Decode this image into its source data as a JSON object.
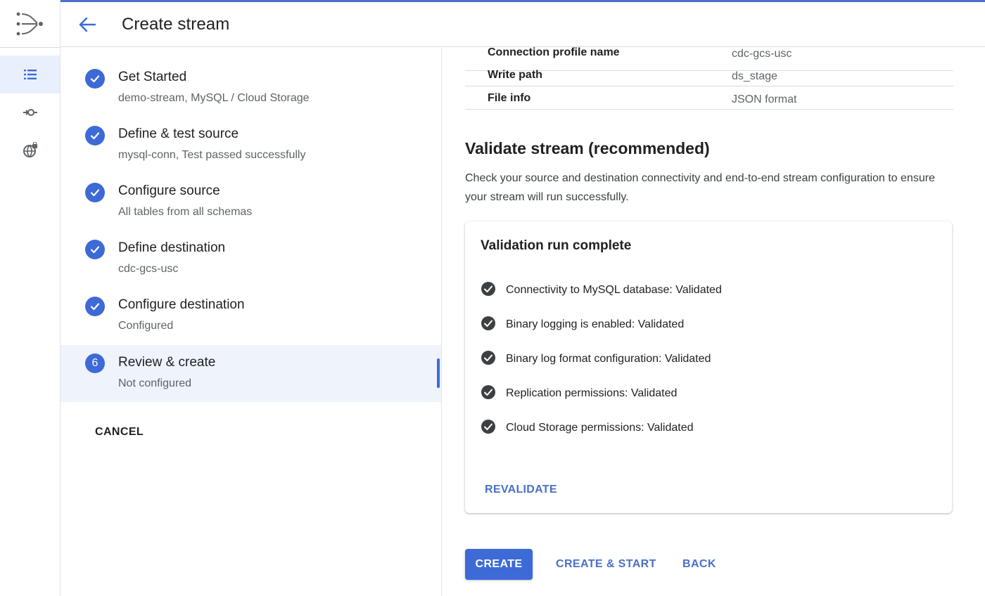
{
  "header": {
    "title": "Create stream"
  },
  "rail": {
    "items": [
      {
        "icon": "list-icon",
        "active": true
      },
      {
        "icon": "connection-profile-icon",
        "active": false
      },
      {
        "icon": "private-connectivity-icon",
        "active": false
      }
    ]
  },
  "stepper": {
    "steps": [
      {
        "title": "Get Started",
        "subtitle": "demo-stream, MySQL / Cloud Storage",
        "status": "complete"
      },
      {
        "title": "Define & test source",
        "subtitle": "mysql-conn, Test passed successfully",
        "status": "complete"
      },
      {
        "title": "Configure source",
        "subtitle": "All tables from all schemas",
        "status": "complete"
      },
      {
        "title": "Define destination",
        "subtitle": "cdc-gcs-usc",
        "status": "complete"
      },
      {
        "title": "Configure destination",
        "subtitle": "Configured",
        "status": "complete"
      },
      {
        "title": "Review & create",
        "subtitle": "Not configured",
        "status": "active",
        "number": "6"
      }
    ],
    "cancel_label": "CANCEL"
  },
  "summary": {
    "rows": [
      {
        "key": "Connection profile name",
        "value": "cdc-gcs-usc"
      },
      {
        "key": "Write path",
        "value": "ds_stage"
      },
      {
        "key": "File info",
        "value": "JSON format"
      }
    ]
  },
  "validate": {
    "title": "Validate stream (recommended)",
    "description": "Check your source and destination connectivity and end-to-end stream configuration to ensure your stream will run successfully.",
    "card_title": "Validation run complete",
    "checks": [
      "Connectivity to MySQL database: Validated",
      "Binary logging is enabled: Validated",
      "Binary log format configuration: Validated",
      "Replication permissions: Validated",
      "Cloud Storage permissions: Validated"
    ],
    "revalidate_label": "REVALIDATE"
  },
  "actions": {
    "create_label": "CREATE",
    "create_start_label": "CREATE & START",
    "back_label": "BACK"
  },
  "colors": {
    "accent": "#3d6ad6",
    "link": "#4a6fc6",
    "active_bg": "#eef3fc"
  }
}
